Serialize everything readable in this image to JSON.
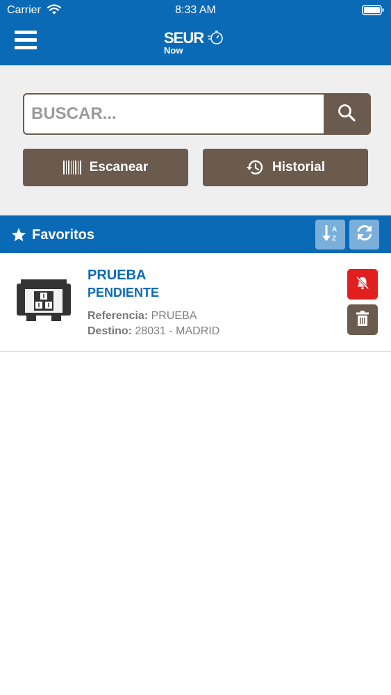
{
  "status_bar": {
    "carrier": "Carrier",
    "time": "8:33 AM"
  },
  "nav": {
    "logo_main": "SEUR",
    "logo_sub": "Now",
    "brand_color": "#0b6ab6"
  },
  "search": {
    "placeholder": "BUSCAR...",
    "value": ""
  },
  "actions": {
    "scan_label": "Escanear",
    "history_label": "Historial"
  },
  "favorites": {
    "title": "Favoritos",
    "items": [
      {
        "name": "PRUEBA",
        "status": "PENDIENTE",
        "reference_label": "Referencia:",
        "reference_value": "PRUEBA",
        "destination_label": "Destino:",
        "destination_value": "28031 - MADRID"
      }
    ]
  },
  "icons": [
    "wifi-icon",
    "battery-icon",
    "menu-icon",
    "search-icon",
    "barcode-icon",
    "history-icon",
    "star-icon",
    "sort-az-icon",
    "refresh-icon",
    "package-icon",
    "bell-off-icon",
    "trash-icon"
  ],
  "colors": {
    "primary": "#0b6ab6",
    "button_brown": "#6b5a4e",
    "danger": "#e11f1f",
    "tool_light": "#7aafdc",
    "background": "#efeff0"
  }
}
